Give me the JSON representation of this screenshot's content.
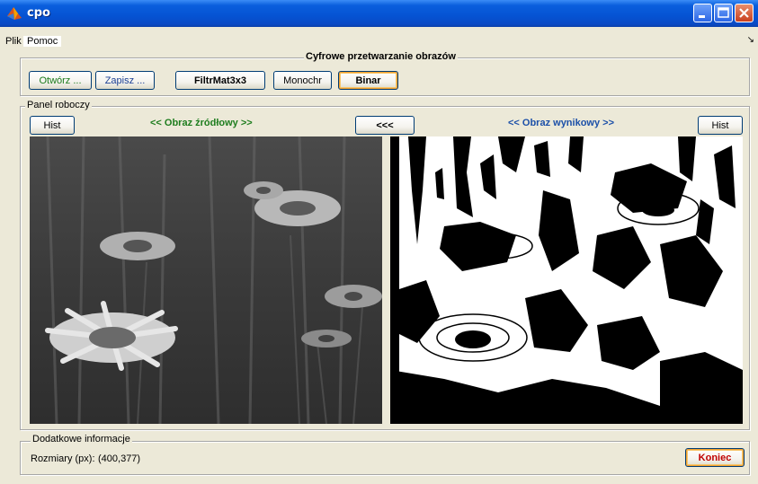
{
  "window": {
    "title": "cpo",
    "icon": "matlab-icon",
    "controls": [
      "minimize-icon",
      "maximize-icon",
      "close-icon"
    ]
  },
  "menu": {
    "items": [
      "Plik",
      "Pomoc"
    ]
  },
  "toolbar_panel": {
    "title": "Cyfrowe przetwarzanie obrazów",
    "buttons": {
      "open": "Otwórz ...",
      "save": "Zapisz ...",
      "filter": "FiltrMat3x3",
      "mono": "Monochr",
      "binar": "Binar"
    }
  },
  "work_panel": {
    "title": "Panel roboczy",
    "hist_left": "Hist",
    "source_label": "<< Obraz źródłowy >>",
    "copy_back": "<<<",
    "result_label": "<< Obraz wynikowy >>",
    "hist_right": "Hist"
  },
  "info_panel": {
    "title": "Dodatkowe informacje",
    "size_label": "Rozmiary (px):",
    "size_value": "(400,377)",
    "close_button": "Koniec"
  },
  "colors": {
    "source_label": "#1e7d1e",
    "result_label": "#1b4fa8",
    "close_button_text": "#c00000"
  }
}
